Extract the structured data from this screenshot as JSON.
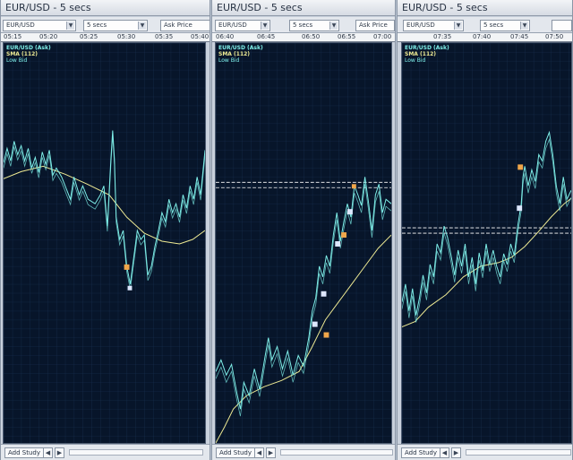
{
  "panels": [
    {
      "title": "EUR/USD - 5 secs",
      "instrument": "EUR/USD",
      "interval": "5 secs",
      "price_type": "Ask Price",
      "time_ticks": [
        "05:15",
        "05:20",
        "05:25",
        "05:30",
        "05:35",
        "05:40"
      ],
      "legend": {
        "ask": "EUR/USD (Ask)",
        "sma": "SMA (112)",
        "bid": "Low Bid"
      },
      "add_study": "Add Study"
    },
    {
      "title": "EUR/USD - 5 secs",
      "instrument": "EUR/USD",
      "interval": "5 secs",
      "price_type": "Ask Price",
      "time_ticks": [
        "06:40",
        "06:45",
        "06:50",
        "06:55",
        "07:00"
      ],
      "legend": {
        "ask": "EUR/USD (Ask)",
        "sma": "SMA (112)",
        "bid": "Low Bid"
      },
      "add_study": "Add Study"
    },
    {
      "title": "EUR/USD - 5 secs",
      "instrument": "EUR/USD",
      "interval": "5 secs",
      "price_type": "",
      "time_ticks": [
        "07:35",
        "07:40",
        "07:45",
        "07:50"
      ],
      "legend": {
        "ask": "EUR/USD (Ask)",
        "sma": "SMA (112)",
        "bid": "Low Bid"
      },
      "add_study": "Add Study"
    }
  ],
  "colors": {
    "background": "#07152a",
    "grid": "#1a3355",
    "price": "#7ff0ea",
    "sma": "#efeb94",
    "marker_buy": "#f0a64a",
    "marker_sell": "#dde7ff"
  }
}
